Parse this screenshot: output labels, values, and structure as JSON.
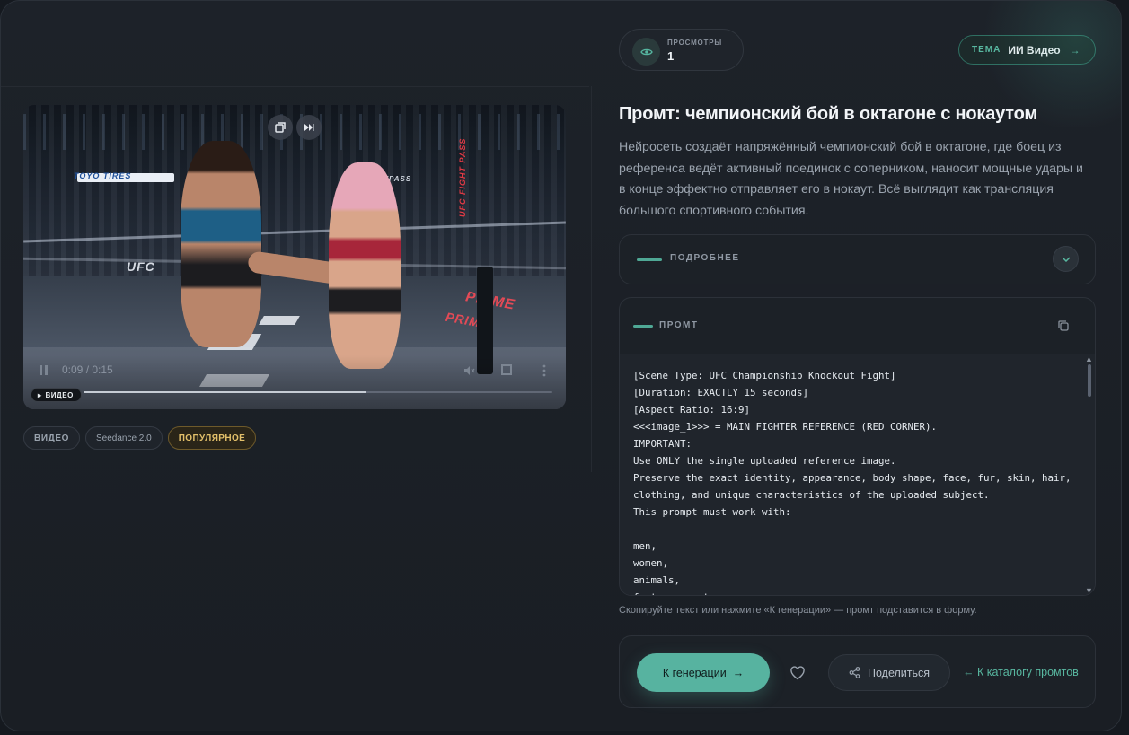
{
  "stats": {
    "views_label": "ПРОСМОТРЫ",
    "views_value": "1"
  },
  "theme": {
    "label": "ТЕМА",
    "value": "ИИ Видео",
    "arrow": "→"
  },
  "video": {
    "time": "0:09 / 0:15",
    "progress": 0.6,
    "badge": "ВИДЕО",
    "sponsors": [
      "TOYO TIRES",
      "UFC",
      "PRIME",
      "PRIME",
      "UFC FIGHT PASS",
      "FIGHTPASS"
    ]
  },
  "tags": [
    {
      "label": "ВИДЕО"
    },
    {
      "label": "Seedance 2.0"
    },
    {
      "label": "ПОПУЛЯРНОЕ"
    }
  ],
  "title": "Промт: чемпионский бой в октагоне с нокаутом",
  "description": "Нейросеть создаёт напряжённый чемпионский бой в октагоне, где боец из референса ведёт активный поединок с соперником, наносит мощные удары и в конце эффектно отправляет его в нокаут. Всё выглядит как трансляция большого спортивного события.",
  "details": {
    "label": "ПОДРОБНЕЕ"
  },
  "prompt": {
    "label": "ПРОМТ",
    "lines": [
      "[Scene Type: UFC Championship Knockout Fight]",
      "[Duration: EXACTLY 15 seconds]",
      "[Aspect Ratio: 16:9]",
      "<<<image_1>>> = MAIN FIGHTER REFERENCE (RED CORNER).",
      "IMPORTANT:",
      "Use ONLY the single uploaded reference image.",
      "Preserve the exact identity, appearance, body shape, face, fur, skin, hair,",
      "clothing, and unique characteristics of the uploaded subject.",
      "This prompt must work with:",
      "",
      "men,",
      "women,",
      "animals,",
      "fantasy creatures,"
    ]
  },
  "hint": "Скопируйте текст или нажмите «К генерации» — промт подставится в форму.",
  "actions": {
    "generate": "К генерации",
    "generate_arrow": "→",
    "share": "Поделиться",
    "catalog": "← К каталогу промтов"
  },
  "colors": {
    "accent": "#57b3a0",
    "popular": "#e3c06a",
    "background": "#1a1e24"
  }
}
